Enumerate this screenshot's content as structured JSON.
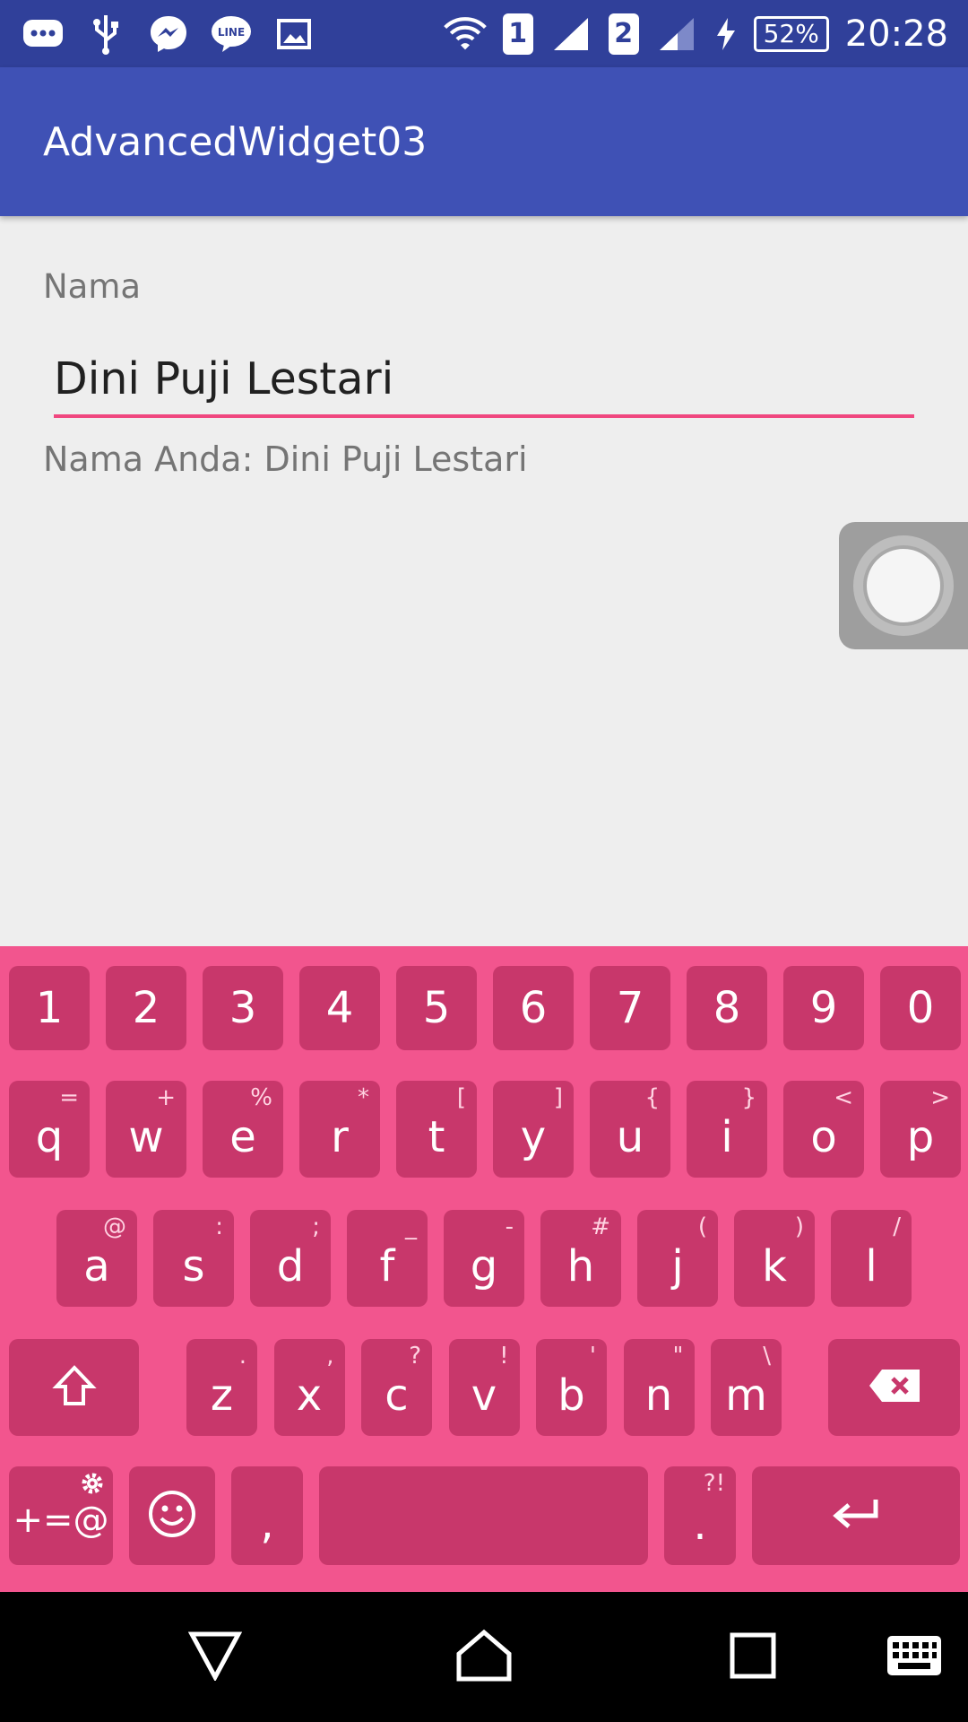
{
  "status_bar": {
    "left_icons": [
      "chat-bubble-icon",
      "usb-icon",
      "messenger-icon",
      "line-icon",
      "image-icon"
    ],
    "sim1_label": "1",
    "sim2_label": "2",
    "battery_text": "52%",
    "time": "20:28"
  },
  "app_bar": {
    "title": "AdvancedWidget03"
  },
  "form": {
    "name_label": "Nama",
    "name_value": "Dini Puji Lestari",
    "output_text": "Nama Anda: Dini Puji Lestari"
  },
  "keyboard": {
    "accent_color": "#f2558e",
    "key_color": "#c8376b",
    "number_row": [
      "1",
      "2",
      "3",
      "4",
      "5",
      "6",
      "7",
      "8",
      "9",
      "0"
    ],
    "row1": [
      {
        "key": "q",
        "hint": "="
      },
      {
        "key": "w",
        "hint": "+"
      },
      {
        "key": "e",
        "hint": "%"
      },
      {
        "key": "r",
        "hint": "*"
      },
      {
        "key": "t",
        "hint": "["
      },
      {
        "key": "y",
        "hint": "]"
      },
      {
        "key": "u",
        "hint": "{"
      },
      {
        "key": "i",
        "hint": "}"
      },
      {
        "key": "o",
        "hint": "<"
      },
      {
        "key": "p",
        "hint": ">"
      }
    ],
    "row2": [
      {
        "key": "a",
        "hint": "@"
      },
      {
        "key": "s",
        "hint": ":"
      },
      {
        "key": "d",
        "hint": ";"
      },
      {
        "key": "f",
        "hint": "_"
      },
      {
        "key": "g",
        "hint": "-"
      },
      {
        "key": "h",
        "hint": "#"
      },
      {
        "key": "j",
        "hint": "("
      },
      {
        "key": "k",
        "hint": ")"
      },
      {
        "key": "l",
        "hint": "/"
      }
    ],
    "row3": [
      {
        "key": "z",
        "hint": "."
      },
      {
        "key": "x",
        "hint": ","
      },
      {
        "key": "c",
        "hint": "?"
      },
      {
        "key": "v",
        "hint": "!"
      },
      {
        "key": "b",
        "hint": "'"
      },
      {
        "key": "n",
        "hint": "\""
      },
      {
        "key": "m",
        "hint": "\\"
      }
    ],
    "symbols_label": "+=@",
    "comma_label": ",",
    "period_label": ".",
    "period_hint": "?!"
  },
  "nav_bar": {
    "buttons": [
      "back-icon",
      "home-icon",
      "recents-icon",
      "keyboard-icon"
    ]
  }
}
